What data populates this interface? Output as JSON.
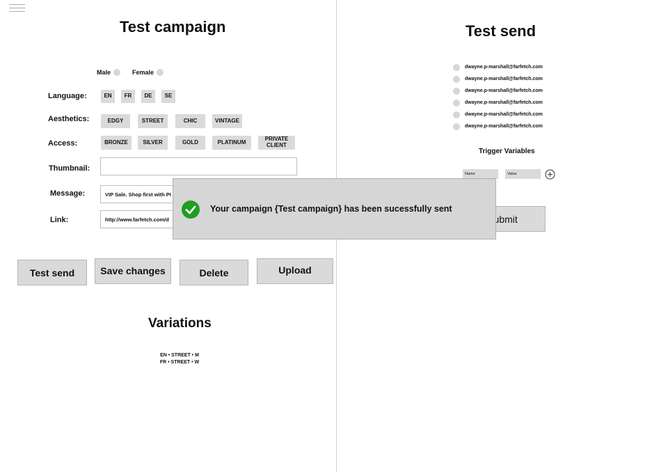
{
  "left": {
    "title": "Test campaign",
    "gender": {
      "male_label": "Male",
      "female_label": "Female"
    },
    "language": {
      "label": "Language:",
      "options": [
        "EN",
        "FR",
        "DE",
        "SE"
      ]
    },
    "aesthetics": {
      "label": "Aesthetics:",
      "options": [
        "EDGY",
        "STREET",
        "CHIC",
        "VINTAGE"
      ]
    },
    "access": {
      "label": "Access:",
      "options": [
        "BRONZE",
        "SILVER",
        "GOLD",
        "PLATINUM",
        "PRIVATE CLIENT"
      ]
    },
    "thumbnail": {
      "label": "Thumbnail:",
      "value": ""
    },
    "message": {
      "label": "Message:",
      "value": "VIP Sale. Shop first with PI"
    },
    "link": {
      "label": "Link:",
      "value": "http://www.farfetch.com/d"
    },
    "buttons": {
      "test_send": "Test send",
      "save": "Save changes",
      "delete": "Delete",
      "upload": "Upload"
    },
    "variations": {
      "title": "Variations",
      "items": [
        "EN • STREET • M",
        "FR • STREET • W"
      ]
    }
  },
  "right": {
    "title": "Test send",
    "emails": [
      "dwayne.p-marshall@farfetch.com",
      "dwayne.p-marshall@farfetch.com",
      "dwayne.p-marshall@farfetch.com",
      "dwayne.p-marshall@farfetch.com",
      "dwayne.p-marshall@farfetch.com",
      "dwayne.p-marshall@farfetch.com"
    ],
    "trigger_variables": {
      "title": "Trigger Variables",
      "name_placeholder": "Name",
      "value_placeholder": "Value"
    },
    "submit_label": "Submit"
  },
  "toast": {
    "message": "Your campaign {Test campaign} has been sucessfully sent",
    "icon": "check-circle-icon",
    "icon_color": "#1f9e1f"
  },
  "icons": {
    "menu": "hamburger-icon",
    "add": "plus-circle-icon"
  }
}
